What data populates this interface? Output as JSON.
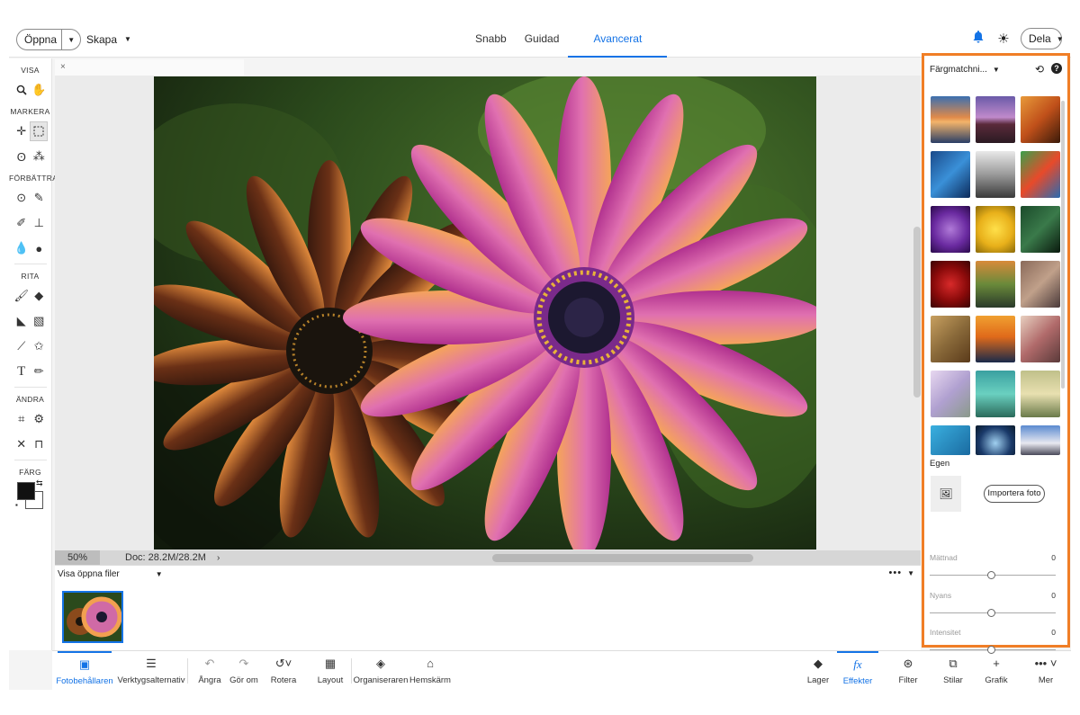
{
  "topbar": {
    "open_label": "Öppna",
    "create_label": "Skapa",
    "modes": [
      "Snabb",
      "Guidad",
      "Avancerat"
    ],
    "active_mode": "Avancerat",
    "share_label": "Dela",
    "icons": [
      "bell-icon",
      "brightness-icon"
    ]
  },
  "tools": {
    "sections": [
      "VISA",
      "MARKERA",
      "FÖRBÄTTRA",
      "RITA",
      "ÄNDRA",
      "FÄRG"
    ],
    "foreground_color": "#111111",
    "background_color": "#ffffff"
  },
  "document": {
    "close_symbol": "×",
    "zoom": "50%",
    "doc_size": "Doc: 28.2M/28.2M",
    "expand_symbol": "›"
  },
  "bin": {
    "dropdown_label": "Visa öppna filer",
    "more_symbol": "•••"
  },
  "bottombar": {
    "photo_bin": "Fotobehållaren",
    "tool_options": "Verktygsalternativ",
    "undo": "Ångra",
    "redo": "Gör om",
    "rotate": "Rotera",
    "layout": "Layout",
    "organizer": "Organiseraren",
    "home": "Hemskärm",
    "layers": "Lager",
    "effects": "Effekter",
    "filter": "Filter",
    "styles": "Stilar",
    "graphics": "Grafik",
    "more": "Mer",
    "fx_symbol": "fx"
  },
  "panel": {
    "title": "Färgmatchni...",
    "custom_label": "Egen",
    "import_label": "Importera foto",
    "sliders": [
      {
        "label": "Mättnad",
        "value": "0"
      },
      {
        "label": "Nyans",
        "value": "0"
      },
      {
        "label": "Intensitet",
        "value": "0"
      }
    ],
    "accent_color": "#f07e26"
  }
}
